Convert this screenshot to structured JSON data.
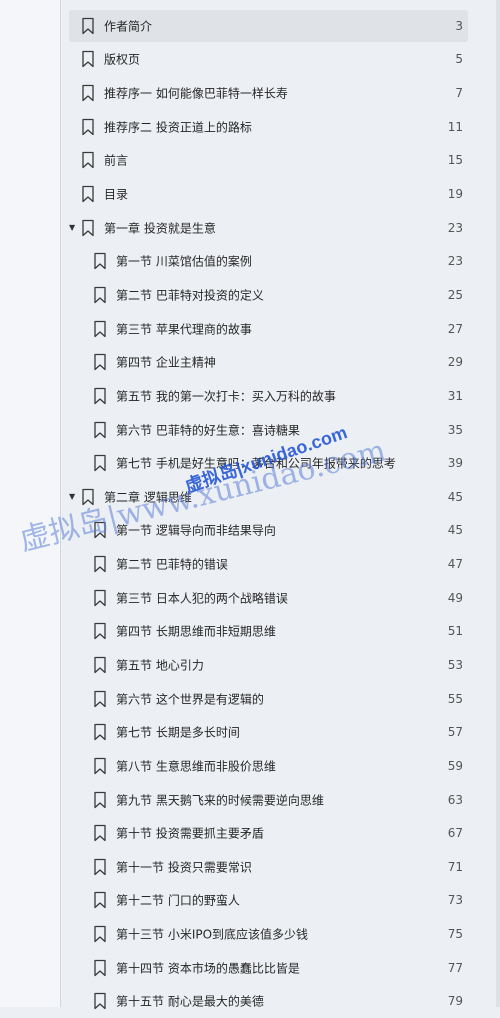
{
  "toc": {
    "items": [
      {
        "label": "作者简介",
        "page": "3",
        "level": 0,
        "selected": true
      },
      {
        "label": "版权页",
        "page": "5",
        "level": 0
      },
      {
        "label": "推荐序一 如何能像巴菲特一样长寿",
        "page": "7",
        "level": 0
      },
      {
        "label": "推荐序二 投资正道上的路标",
        "page": "11",
        "level": 0
      },
      {
        "label": "前言",
        "page": "15",
        "level": 0
      },
      {
        "label": "目录",
        "page": "19",
        "level": 0
      },
      {
        "label": "第一章 投资就是生意",
        "page": "23",
        "level": 0,
        "expanded": true
      },
      {
        "label": "第一节 川菜馆估值的案例",
        "page": "23",
        "level": 1
      },
      {
        "label": "第二节 巴菲特对投资的定义",
        "page": "25",
        "level": 1
      },
      {
        "label": "第三节 苹果代理商的故事",
        "page": "27",
        "level": 1
      },
      {
        "label": "第四节 企业主精神",
        "page": "29",
        "level": 1
      },
      {
        "label": "第五节 我的第一次打卡：买入万科的故事",
        "page": "31",
        "level": 1
      },
      {
        "label": "第六节 巴菲特的好生意：喜诗糖果",
        "page": "35",
        "level": 1
      },
      {
        "label": "第七节 手机是好生意吗：茅台和公司年报带来的思考",
        "page": "39",
        "level": 1
      },
      {
        "label": "第二章 逻辑思维",
        "page": "45",
        "level": 0,
        "expanded": true
      },
      {
        "label": "第一节 逻辑导向而非结果导向",
        "page": "45",
        "level": 1
      },
      {
        "label": "第二节 巴菲特的错误",
        "page": "47",
        "level": 1
      },
      {
        "label": "第三节 日本人犯的两个战略错误",
        "page": "49",
        "level": 1
      },
      {
        "label": "第四节 长期思维而非短期思维",
        "page": "51",
        "level": 1
      },
      {
        "label": "第五节 地心引力",
        "page": "53",
        "level": 1
      },
      {
        "label": "第六节 这个世界是有逻辑的",
        "page": "55",
        "level": 1
      },
      {
        "label": "第七节 长期是多长时间",
        "page": "57",
        "level": 1
      },
      {
        "label": "第八节 生意思维而非股价思维",
        "page": "59",
        "level": 1
      },
      {
        "label": "第九节 黑天鹅飞来的时候需要逆向思维",
        "page": "63",
        "level": 1
      },
      {
        "label": "第十节 投资需要抓主要矛盾",
        "page": "67",
        "level": 1
      },
      {
        "label": "第十一节 投资只需要常识",
        "page": "71",
        "level": 1
      },
      {
        "label": "第十二节 门口的野蛮人",
        "page": "73",
        "level": 1
      },
      {
        "label": "第十三节 小米IPO到底应该值多少钱",
        "page": "75",
        "level": 1
      },
      {
        "label": "第十四节 资本市场的愚蠢比比皆是",
        "page": "77",
        "level": 1
      },
      {
        "label": "第十五节 耐心是最大的美德",
        "page": "79",
        "level": 1
      }
    ]
  },
  "watermark": {
    "logo_text": "虚拟岛|xunidao.com",
    "text": "虚拟岛|www.xunidao.com",
    "color_logo": "#1a4fd6",
    "color_text": "#5b7fd8"
  },
  "colors": {
    "background": "#eceff3",
    "selected_row": "#dfe2e6",
    "text": "#262626"
  }
}
